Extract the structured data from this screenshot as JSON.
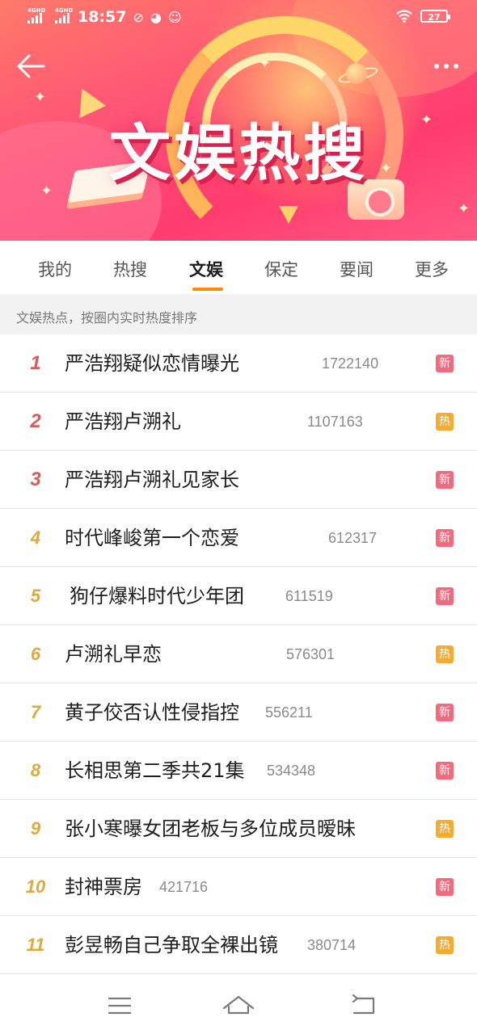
{
  "status_bar": {
    "network1": "4GHD",
    "network2": "4GHD",
    "time": "18:57",
    "battery": "27",
    "icons": [
      "sync-icon",
      "weibo-icon",
      "wechat-icon",
      "wifi-icon",
      "battery-icon"
    ]
  },
  "header": {
    "title": "文娱热搜",
    "back_icon": "arrow-left-icon",
    "more_icon": "more-dots-icon"
  },
  "tabs": [
    {
      "label": "我的",
      "active": false
    },
    {
      "label": "热搜",
      "active": false
    },
    {
      "label": "文娱",
      "active": true
    },
    {
      "label": "保定",
      "active": false
    },
    {
      "label": "要闻",
      "active": false
    },
    {
      "label": "更多",
      "active": false
    }
  ],
  "info_text": "文娱热点，按圈内实时热度排序",
  "list": [
    {
      "rank": "1",
      "title": "严浩翔疑似恋情曝光",
      "count": "1722140",
      "badge": "新",
      "badge_type": "new"
    },
    {
      "rank": "2",
      "title": "严浩翔卢溯礼",
      "count": "1107163",
      "badge": "热",
      "badge_type": "hot"
    },
    {
      "rank": "3",
      "title": "严浩翔卢溯礼见家长",
      "count": "",
      "badge": "新",
      "badge_type": "new"
    },
    {
      "rank": "4",
      "title": "时代峰峻第一个恋爱",
      "count": "612317",
      "badge": "新",
      "badge_type": "new"
    },
    {
      "rank": "5",
      "title": "狗仔爆料时代少年团",
      "count": "611519",
      "badge": "新",
      "badge_type": "new"
    },
    {
      "rank": "6",
      "title": "卢溯礼早恋",
      "count": "576301",
      "badge": "热",
      "badge_type": "hot"
    },
    {
      "rank": "7",
      "title": "黄子佼否认性侵指控",
      "count": "556211",
      "badge": "新",
      "badge_type": "new"
    },
    {
      "rank": "8",
      "title": "长相思第二季共21集",
      "count": "534348",
      "badge": "新",
      "badge_type": "new"
    },
    {
      "rank": "9",
      "title": "张小寒曝女团老板与多位成员暧昧",
      "count": "",
      "badge": "热",
      "badge_type": "hot"
    },
    {
      "rank": "10",
      "title": "封神票房",
      "count": "421716",
      "badge": "新",
      "badge_type": "new"
    },
    {
      "rank": "11",
      "title": "彭昱畅自己争取全裸出镜",
      "count": "380714",
      "badge": "热",
      "badge_type": "hot"
    }
  ],
  "nav": {
    "menu_icon": "menu-icon",
    "home_icon": "home-icon",
    "back_icon": "back-icon"
  }
}
